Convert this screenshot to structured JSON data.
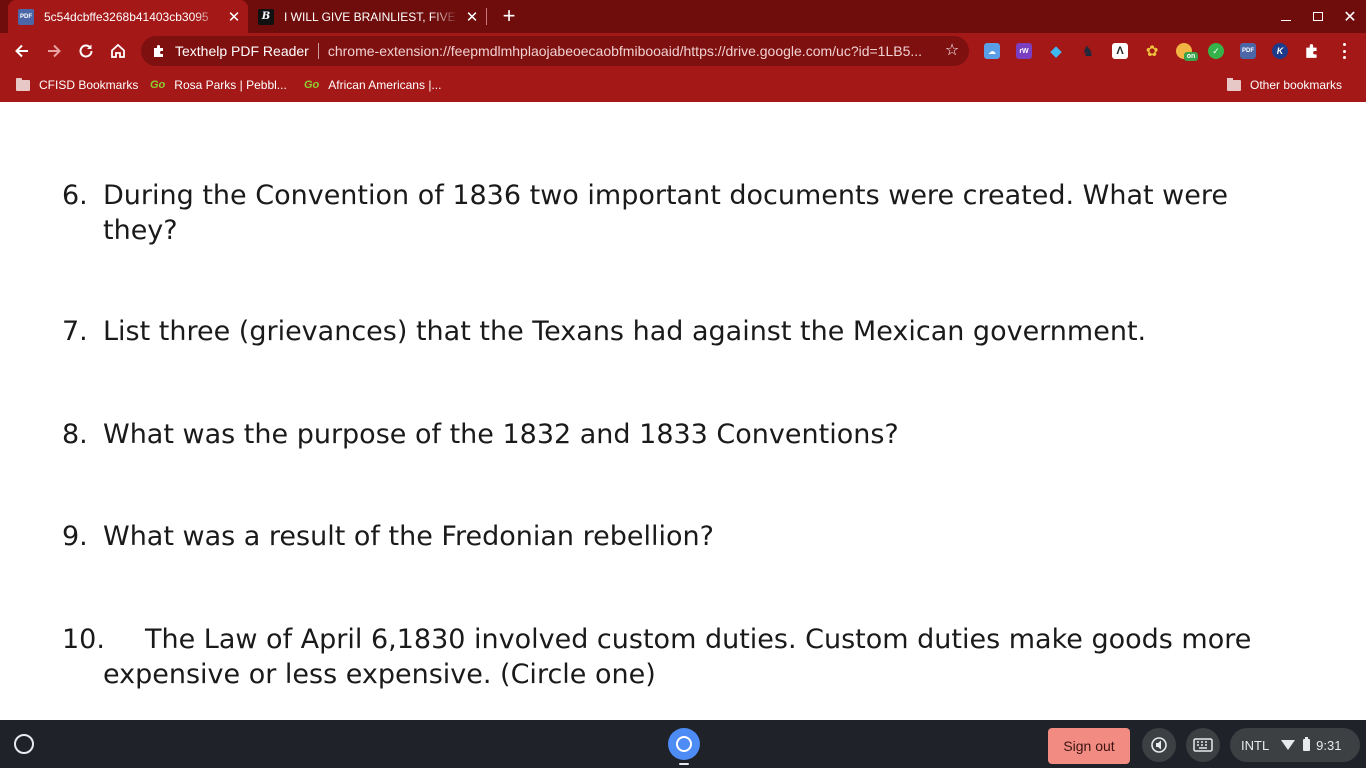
{
  "browser": {
    "tabs": [
      {
        "title": "5c54dcbffe3268b41403cb3095",
        "favicon": "pdf-icon",
        "active": true
      },
      {
        "title": "I WILL GIVE BRAINLIEST, FIVE ST",
        "favicon": "brainly-b-icon",
        "active": false
      }
    ],
    "omnibox": {
      "site_label": "Texthelp PDF Reader",
      "url": "chrome-extension://feepmdlmhplaojabeoecaobfmibooaid/https://drive.google.com/uc?id=1LB5..."
    },
    "bookmarks": [
      {
        "label": "CFISD Bookmarks",
        "icon": "folder-icon"
      },
      {
        "label": "Rosa Parks | Pebbl...",
        "icon": "gogo-icon",
        "prefix": "Go"
      },
      {
        "label": "African Americans |...",
        "icon": "gogo-icon",
        "prefix": "Go"
      }
    ],
    "other_bookmarks": "Other bookmarks",
    "colors": {
      "frame": "#6f0d0d",
      "toolbar": "#a41818",
      "omnibox": "#7f1010"
    }
  },
  "document": {
    "questions": [
      {
        "num": "6.",
        "line1": "During the Convention of 1836 two important documents were created. What were",
        "line2": "they?"
      },
      {
        "num": "7.",
        "line1": "List three (grievances) that the Texans had against the Mexican government.",
        "line2": ""
      },
      {
        "num": "8.",
        "line1": "What was the purpose of the 1832 and 1833 Conventions?",
        "line2": ""
      },
      {
        "num": "9.",
        "line1": "What was a result of the Fredonian rebellion?",
        "line2": ""
      },
      {
        "num": "10.",
        "line1": "The Law of April 6,1830 involved custom duties.  Custom duties make goods more",
        "line2": "expensive or less expensive. (Circle one)"
      }
    ]
  },
  "shelf": {
    "sign_out": "Sign out",
    "input_method": "INTL",
    "time": "9:31"
  }
}
